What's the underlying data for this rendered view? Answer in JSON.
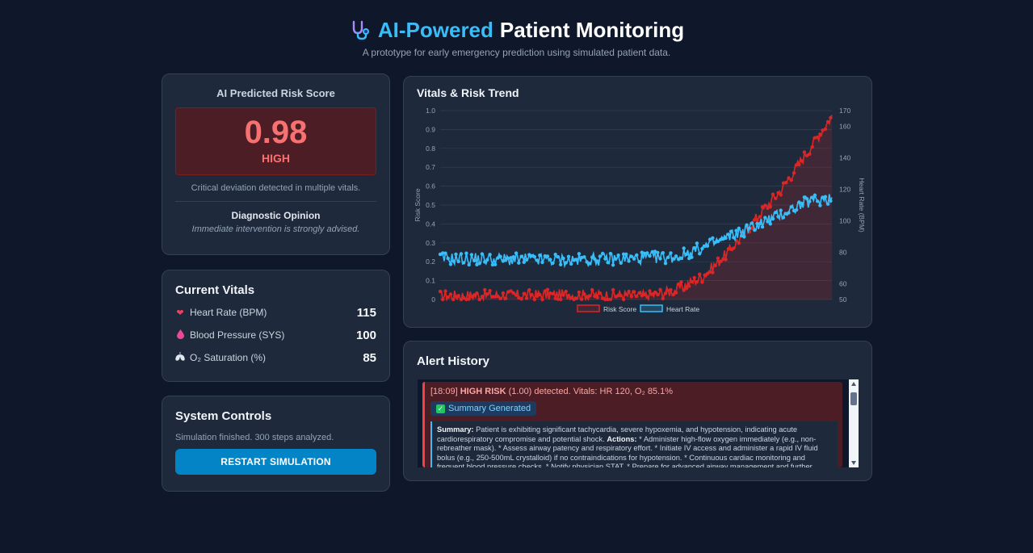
{
  "header": {
    "title_highlight": "AI-Powered",
    "title_rest": "Patient Monitoring",
    "subtitle": "A prototype for early emergency prediction using simulated patient data.",
    "icon": "stethoscope-icon"
  },
  "risk": {
    "label": "AI Predicted Risk Score",
    "value": "0.98",
    "level": "HIGH",
    "description": "Critical deviation detected in multiple vitals.",
    "diagnostic_title": "Diagnostic Opinion",
    "diagnostic_text": "Immediate intervention is strongly advised."
  },
  "vitals": {
    "title": "Current Vitals",
    "items": [
      {
        "label": "Heart Rate (BPM)",
        "value": "115",
        "icon": "heart-icon",
        "icon_color": "#f43f5e"
      },
      {
        "label": "Blood Pressure (SYS)",
        "value": "100",
        "icon": "drop-icon",
        "icon_color": "#ec4899"
      },
      {
        "label": "O₂ Saturation (%)",
        "value": "85",
        "icon": "lungs-icon",
        "icon_color": "#e2e8f0"
      }
    ]
  },
  "controls": {
    "title": "System Controls",
    "status": "Simulation finished. 300 steps analyzed.",
    "restart_label": "RESTART SIMULATION"
  },
  "alerts": {
    "title": "Alert History",
    "items": [
      {
        "time": "[18:09]",
        "level": "HIGH RISK",
        "detail": "(1.00) detected. Vitals: HR 120, O₂ 85.1%",
        "badge": "Summary Generated",
        "summary_label": "Summary:",
        "summary_text": "Patient is exhibiting significant tachycardia, severe hypoxemia, and hypotension, indicating acute cardiorespiratory compromise and potential shock.",
        "actions_label": "Actions:",
        "actions_text": "* Administer high-flow oxygen immediately (e.g., non-rebreather mask). * Assess airway patency and respiratory effort. * Initiate IV access and administer a rapid IV fluid bolus (e.g., 250-500mL crystalloid) if no contraindications for hypotension. * Continuous cardiac monitoring and frequent blood pressure checks. * Notify physician STAT. * Prepare for advanced airway management and further diagnostics (e.g., ABG, ECG, chest X-ray)."
      }
    ]
  },
  "chart_data": {
    "type": "line",
    "title": "Vitals & Risk Trend",
    "x_count": 300,
    "y_left": {
      "label": "Risk Score",
      "range": [
        0,
        1.0
      ],
      "ticks": [
        "0",
        "0.1",
        "0.2",
        "0.3",
        "0.4",
        "0.5",
        "0.6",
        "0.7",
        "0.8",
        "0.9",
        "1.0"
      ]
    },
    "y_right": {
      "label": "Heart Rate (BPM)",
      "range": [
        50,
        170
      ],
      "ticks": [
        "50",
        "60",
        "80",
        "100",
        "120",
        "140",
        "160",
        "170"
      ]
    },
    "legend_position": "bottom",
    "grid": true,
    "series": [
      {
        "name": "Risk Score",
        "axis": "left",
        "color": "#dc2626",
        "fill": "rgba(220,38,38,0.18)",
        "keyframes": [
          [
            0,
            0.02
          ],
          [
            100,
            0.025
          ],
          [
            160,
            0.02
          ],
          [
            180,
            0.05
          ],
          [
            200,
            0.12
          ],
          [
            220,
            0.25
          ],
          [
            240,
            0.42
          ],
          [
            260,
            0.58
          ],
          [
            280,
            0.78
          ],
          [
            300,
            0.98
          ]
        ],
        "noise": 0.03
      },
      {
        "name": "Heart Rate",
        "axis": "right",
        "color": "#38bdf8",
        "fill": "none",
        "keyframes": [
          [
            0,
            76
          ],
          [
            100,
            75
          ],
          [
            180,
            77
          ],
          [
            200,
            83
          ],
          [
            230,
            93
          ],
          [
            260,
            104
          ],
          [
            280,
            112
          ],
          [
            300,
            115
          ]
        ],
        "noise": 4
      }
    ]
  }
}
